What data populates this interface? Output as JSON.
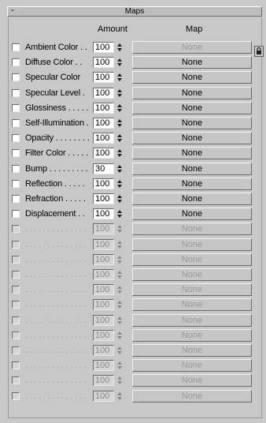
{
  "rollout": {
    "title": "Maps",
    "collapse_symbol": "-"
  },
  "columns": {
    "amount": "Amount",
    "map": "Map"
  },
  "icons": {
    "lock": "lock-icon",
    "spinner": "spinner-arrows"
  },
  "rows": [
    {
      "label": "Ambient Color . .",
      "amount": "100",
      "map": "None",
      "enabled": true
    },
    {
      "label": "Diffuse Color . .",
      "amount": "100",
      "map": "None",
      "enabled": true
    },
    {
      "label": "Specular Color",
      "amount": "100",
      "map": "None",
      "enabled": true
    },
    {
      "label": "Specular Level .",
      "amount": "100",
      "map": "None",
      "enabled": true
    },
    {
      "label": "Glossiness . . . . .",
      "amount": "100",
      "map": "None",
      "enabled": true
    },
    {
      "label": "Self-Illumination .",
      "amount": "100",
      "map": "None",
      "enabled": true
    },
    {
      "label": "Opacity . . . . . . . .",
      "amount": "100",
      "map": "None",
      "enabled": true
    },
    {
      "label": "Filter Color . . . . .",
      "amount": "100",
      "map": "None",
      "enabled": true
    },
    {
      "label": "Bump . . . . . . . . .",
      "amount": "30",
      "map": "None",
      "enabled": true
    },
    {
      "label": "Reflection . . . . .",
      "amount": "100",
      "map": "None",
      "enabled": true
    },
    {
      "label": "Refraction . . . . .",
      "amount": "100",
      "map": "None",
      "enabled": true
    },
    {
      "label": "Displacement . .",
      "amount": "100",
      "map": "None",
      "enabled": true
    },
    {
      "label": ". . . . . . . . . . . . . .",
      "amount": "100",
      "map": "None",
      "enabled": false
    },
    {
      "label": ". . . . . . . . . . . . . .",
      "amount": "100",
      "map": "None",
      "enabled": false
    },
    {
      "label": ". . . . . . . . . . . . . .",
      "amount": "100",
      "map": "None",
      "enabled": false
    },
    {
      "label": ". . . . . . . . . . . . . .",
      "amount": "100",
      "map": "None",
      "enabled": false
    },
    {
      "label": ". . . . . . . . . . . . . .",
      "amount": "100",
      "map": "None",
      "enabled": false
    },
    {
      "label": ". . . . . . . . . . . . . .",
      "amount": "100",
      "map": "None",
      "enabled": false
    },
    {
      "label": ". . . . . . . . . . . . . .",
      "amount": "100",
      "map": "None",
      "enabled": false
    },
    {
      "label": ". . . . . . . . . . . . . .",
      "amount": "100",
      "map": "None",
      "enabled": false
    },
    {
      "label": ". . . . . . . . . . . . . .",
      "amount": "100",
      "map": "None",
      "enabled": false
    },
    {
      "label": ". . . . . . . . . . . . . .",
      "amount": "100",
      "map": "None",
      "enabled": false
    },
    {
      "label": ". . . . . . . . . . . . . .",
      "amount": "100",
      "map": "None",
      "enabled": false
    },
    {
      "label": ". . . . . . . . . . . . . .",
      "amount": "100",
      "map": "None",
      "enabled": false
    }
  ]
}
